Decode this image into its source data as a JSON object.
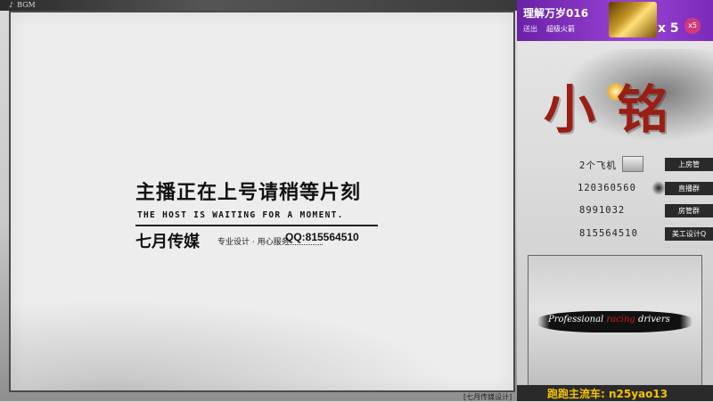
{
  "bgm_bar": {
    "label": "BGM",
    "note_icon": "music-note-icon"
  },
  "stage": {
    "title": "主播正在上号请稍等片刻",
    "subtitle_en": "THE HOST IS WAITING FOR A MOMENT.",
    "brand": "七月传媒",
    "slogan": "专业设计 · 用心服务",
    "qq": "QQ:815564510",
    "credit": "[七月传媒设计]"
  },
  "gift": {
    "user": "理解万岁016",
    "action": "送出",
    "item": "超级火箭",
    "multiplier": "x 5",
    "badge": "x5"
  },
  "side": {
    "big_chars": [
      "小",
      "铭"
    ],
    "rows": [
      {
        "value": "2个飞机",
        "tag": "上房管"
      },
      {
        "value": "120360560",
        "tag": "直播群"
      },
      {
        "value": "8991032",
        "tag": "房管群"
      },
      {
        "value": "815564510",
        "tag": "美工设计Q"
      }
    ],
    "promo": {
      "prefix": "Professional ",
      "highlight": "racing",
      "suffix": " drivers"
    },
    "marquee": "跑跑主流车: n25yao13"
  },
  "colors": {
    "accent_red": "#9a1e14",
    "gift_purple": "#7b2ab8",
    "marquee_yellow": "#f2c300"
  }
}
